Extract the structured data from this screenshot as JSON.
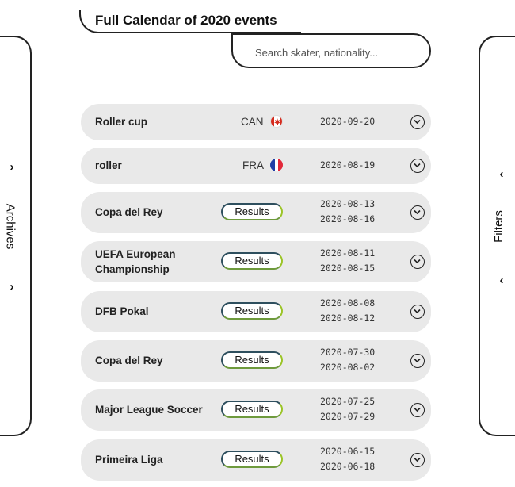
{
  "header": {
    "title": "Full Calendar of 2020 events"
  },
  "search": {
    "placeholder": "Search skater, nationality..."
  },
  "left_panel": {
    "label": "Archives"
  },
  "right_panel": {
    "label": "Filters"
  },
  "events": [
    {
      "name": "Roller cup",
      "country": "CAN",
      "flag": "canada-flag-icon",
      "dates": [
        "2020-09-20"
      ]
    },
    {
      "name": "roller",
      "country": "FRA",
      "flag": "france-flag-icon",
      "dates": [
        "2020-08-19"
      ]
    },
    {
      "name": "Copa del Rey",
      "results_label": "Results",
      "dates": [
        "2020-08-13",
        "2020-08-16"
      ]
    },
    {
      "name": "UEFA European Championship",
      "results_label": "Results",
      "dates": [
        "2020-08-11",
        "2020-08-15"
      ]
    },
    {
      "name": "DFB Pokal",
      "results_label": "Results",
      "dates": [
        "2020-08-08",
        "2020-08-12"
      ]
    },
    {
      "name": "Copa del Rey",
      "results_label": "Results",
      "dates": [
        "2020-07-30",
        "2020-08-02"
      ]
    },
    {
      "name": "Major League Soccer",
      "results_label": "Results",
      "dates": [
        "2020-07-25",
        "2020-07-29"
      ]
    },
    {
      "name": "Primeira Liga",
      "results_label": "Results",
      "dates": [
        "2020-06-15",
        "2020-06-18"
      ]
    }
  ],
  "colors": {
    "row_bg": "#e9e9e9",
    "button_gradient_start": "#2e4f5e",
    "button_gradient_end": "#9bc427"
  }
}
